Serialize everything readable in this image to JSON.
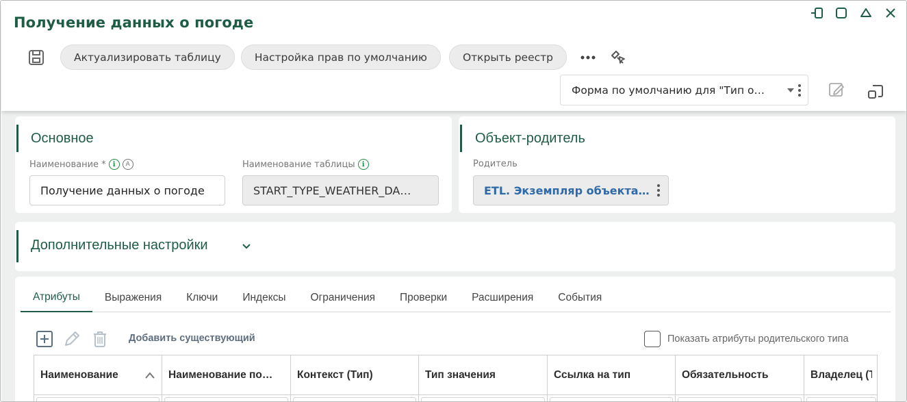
{
  "window": {
    "title": "Получение данных о погоде",
    "controls": [
      "pin-icon",
      "maximize-icon",
      "collapse-icon",
      "close-icon"
    ]
  },
  "toolbar": {
    "save_icon": "save-icon",
    "buttons": [
      {
        "label": "Актуализировать таблицу"
      },
      {
        "label": "Настройка прав по умолчанию"
      },
      {
        "label": "Открыть реестр"
      }
    ],
    "more_icon": "more-horizontal-icon",
    "link_icon": "link-cursor-icon"
  },
  "form_selector": {
    "value": "Форма по умолчанию для \"Тип о…"
  },
  "sections": {
    "main": {
      "title": "Основное",
      "name_label": "Наименование *",
      "name_value": "Получение данных о погоде",
      "table_name_label": "Наименование таблицы",
      "table_name_value": "START_TYPE_WEATHER_DA…"
    },
    "parent": {
      "title": "Объект-родитель",
      "parent_label": "Родитель",
      "parent_value": "ETL. Экземпляр объекта …"
    },
    "extra": {
      "title": "Дополнительные настройки"
    }
  },
  "tabs": [
    {
      "label": "Атрибуты",
      "active": true
    },
    {
      "label": "Выражения"
    },
    {
      "label": "Ключи"
    },
    {
      "label": "Индексы"
    },
    {
      "label": "Ограничения"
    },
    {
      "label": "Проверки"
    },
    {
      "label": "Расширения"
    },
    {
      "label": "События"
    }
  ],
  "grid_toolbar": {
    "add_existing": "Добавить существующий",
    "show_parent_attrs": "Показать атрибуты родительского типа",
    "show_parent_checked": false
  },
  "table": {
    "columns": [
      {
        "label": "Наименование",
        "sort": "asc"
      },
      {
        "label": "Наименование по…"
      },
      {
        "label": "Контекст (Тип)"
      },
      {
        "label": "Тип значения"
      },
      {
        "label": "Ссылка на тип"
      },
      {
        "label": "Обязательность"
      },
      {
        "label": "Владелец (Т"
      }
    ]
  },
  "colors": {
    "accent": "#1f5c45",
    "link": "#2f6aa8",
    "info": "#1e8e3e"
  }
}
